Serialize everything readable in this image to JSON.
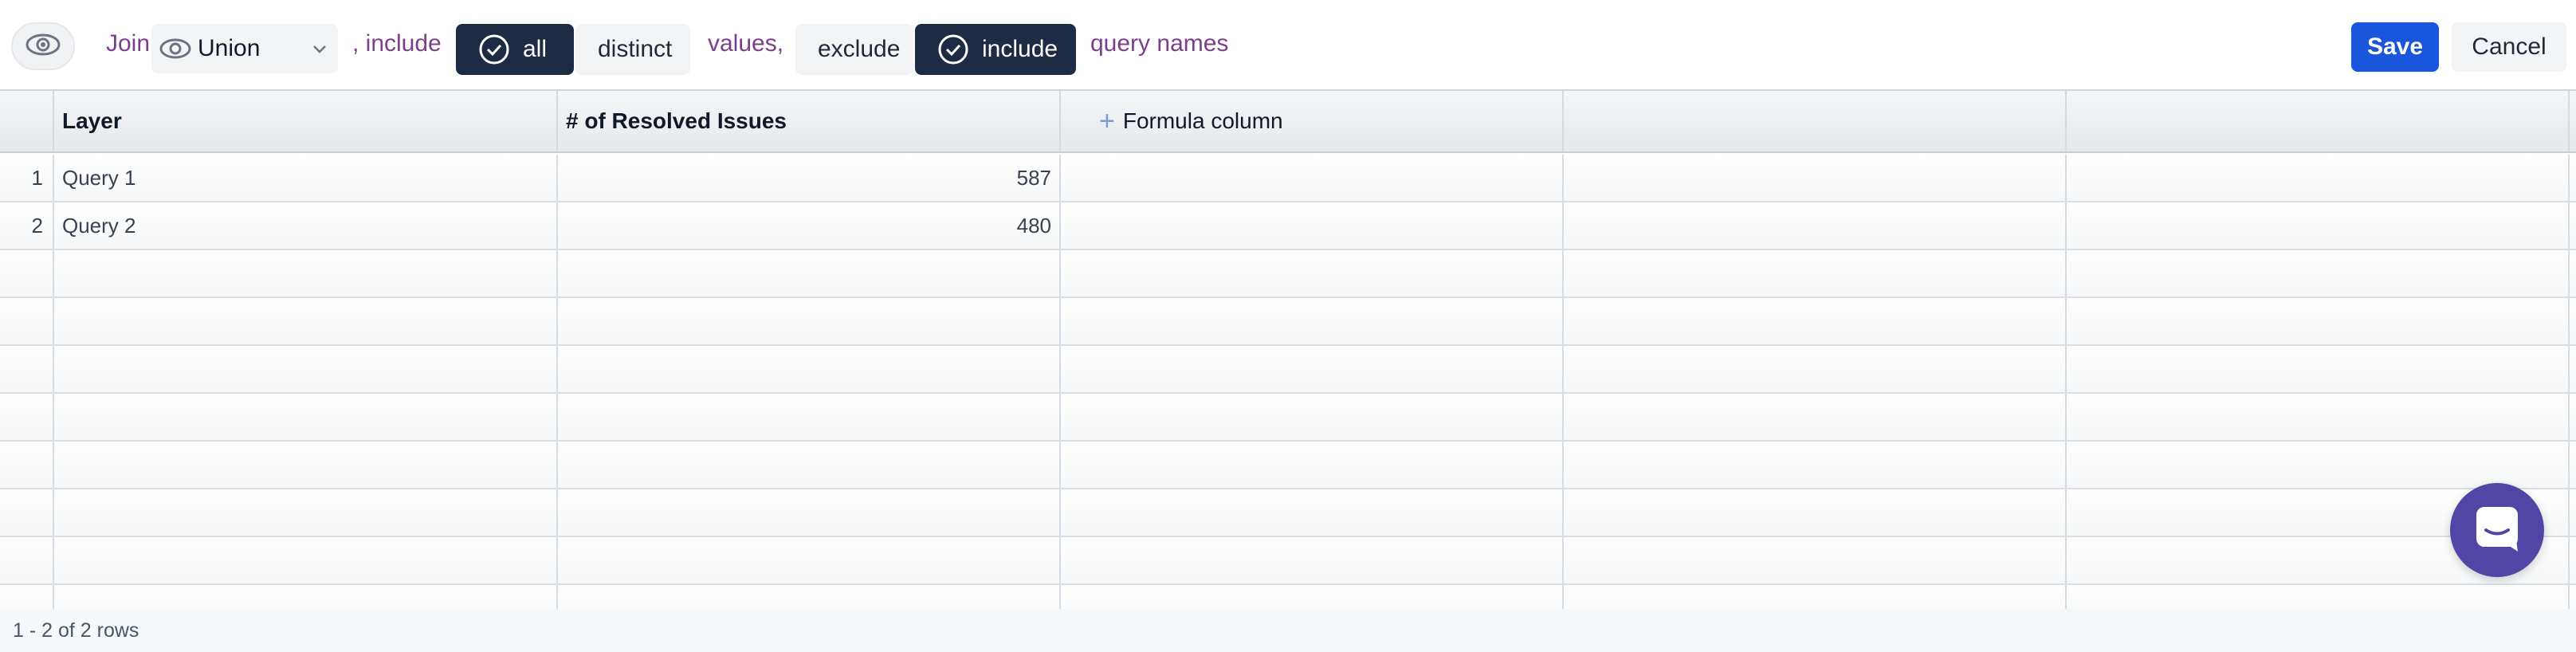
{
  "toolbar": {
    "join_label": "Join",
    "join_select_value": "Union",
    "include_label": ", include",
    "all_label": "all",
    "distinct_label": "distinct",
    "values_label": "values,",
    "exclude_label": "exclude",
    "include_toggle_label": "include",
    "query_names_label": "query names",
    "save_label": "Save",
    "cancel_label": "Cancel"
  },
  "grid": {
    "columns": [
      "Layer",
      "# of Resolved Issues",
      "Formula column",
      "",
      ""
    ],
    "rows": [
      {
        "index": "1",
        "layer": "Query 1",
        "resolved": "587"
      },
      {
        "index": "2",
        "layer": "Query 2",
        "resolved": "480"
      }
    ]
  },
  "footer": {
    "row_count": "1 - 2 of 2 rows"
  },
  "colors": {
    "primary": "#1a56db",
    "dark_toggle": "#1e2b45",
    "accent_text": "#7c3f8c",
    "chat": "#5145a5"
  },
  "icons": [
    "eye-icon",
    "chevron-down-icon",
    "check-circle-icon",
    "plus-icon",
    "chat-icon"
  ]
}
